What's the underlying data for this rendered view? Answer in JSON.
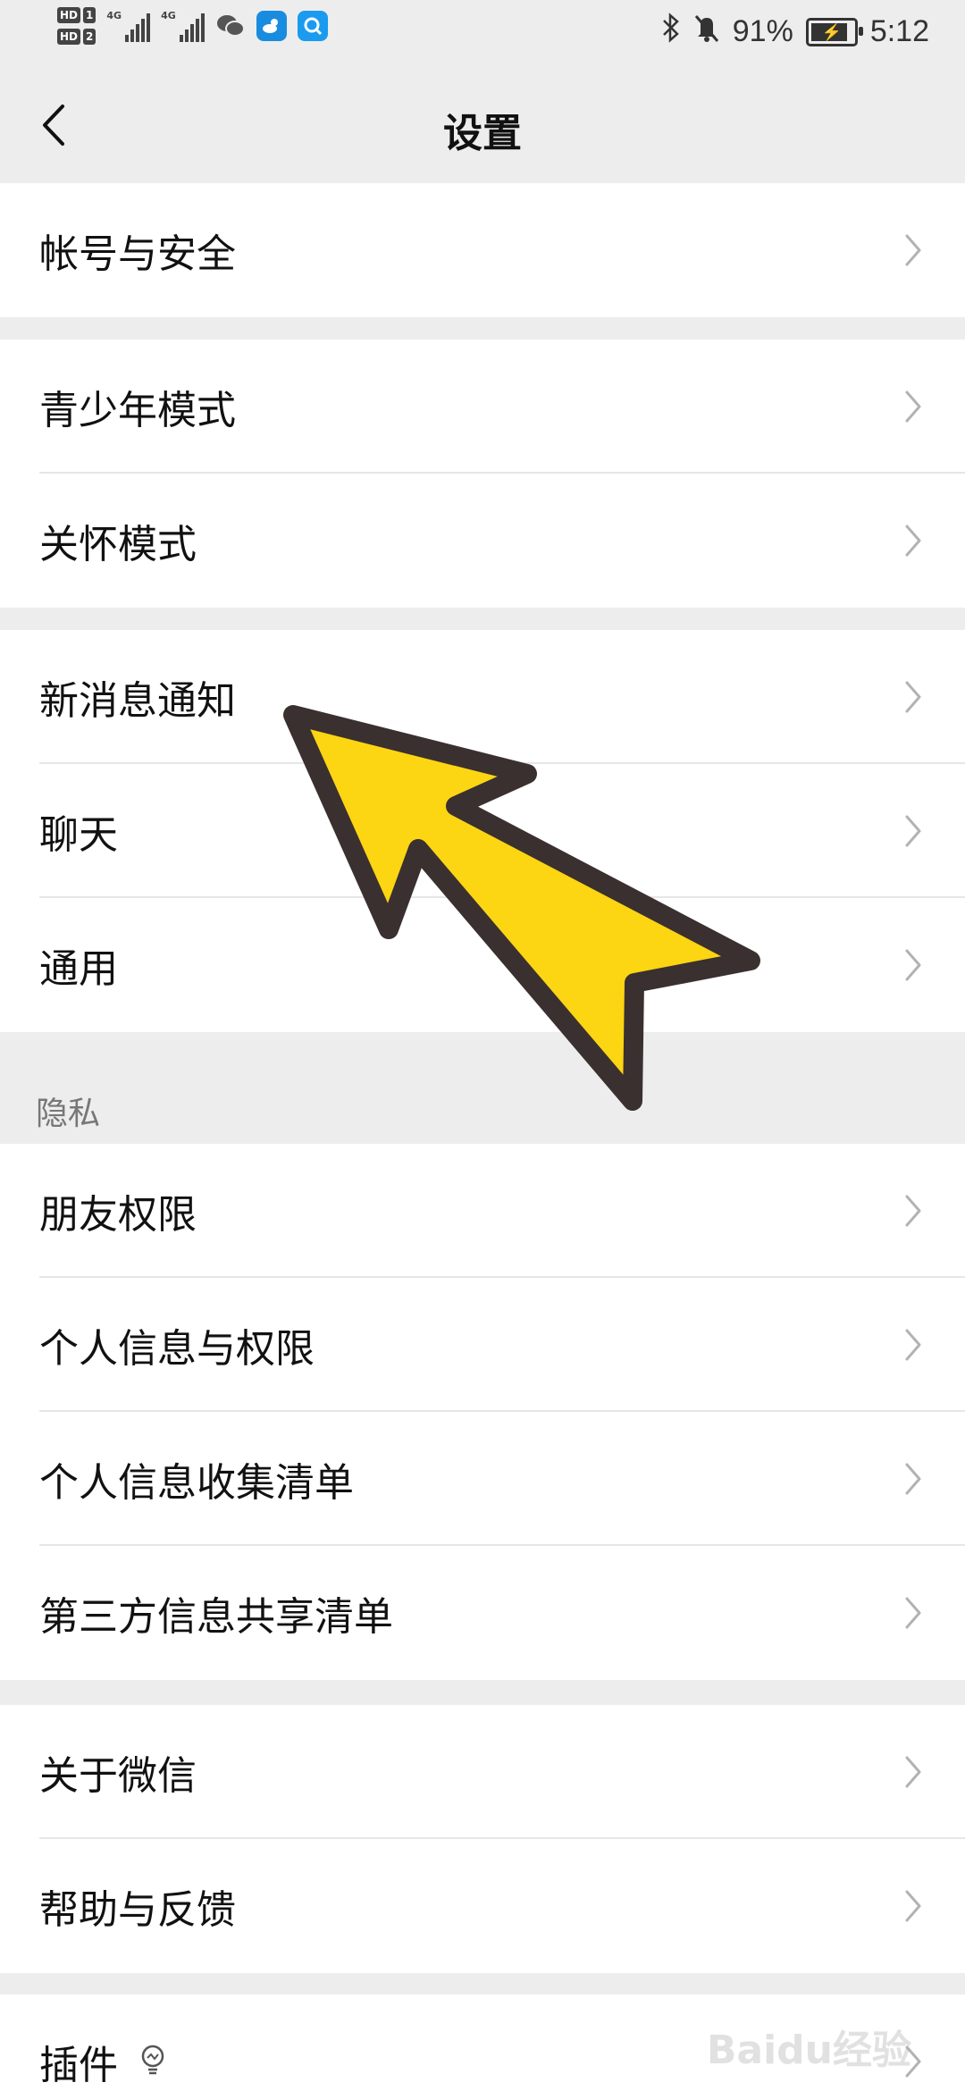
{
  "status_bar": {
    "hd1": "HD",
    "hd1_num": "1",
    "hd2": "HD",
    "hd2_num": "2",
    "net1": "4G",
    "net2": "4G",
    "battery_percent": "91%",
    "time": "5:12"
  },
  "header": {
    "title": "设置"
  },
  "groups": [
    {
      "items": [
        {
          "label": "帐号与安全"
        }
      ]
    },
    {
      "items": [
        {
          "label": "青少年模式"
        },
        {
          "label": "关怀模式"
        }
      ]
    },
    {
      "items": [
        {
          "label": "新消息通知"
        },
        {
          "label": "聊天"
        },
        {
          "label": "通用"
        }
      ]
    },
    {
      "section": "隐私",
      "items": [
        {
          "label": "朋友权限"
        },
        {
          "label": "个人信息与权限"
        },
        {
          "label": "个人信息收集清单"
        },
        {
          "label": "第三方信息共享清单"
        }
      ]
    },
    {
      "items": [
        {
          "label": "关于微信"
        },
        {
          "label": "帮助与反馈"
        }
      ]
    },
    {
      "items": [
        {
          "label": "插件"
        }
      ]
    }
  ],
  "watermark": "Baidu经验",
  "colors": {
    "background": "#ededed",
    "card": "#ffffff",
    "arrow_fill": "#fcd513",
    "arrow_stroke": "#3a3030"
  }
}
